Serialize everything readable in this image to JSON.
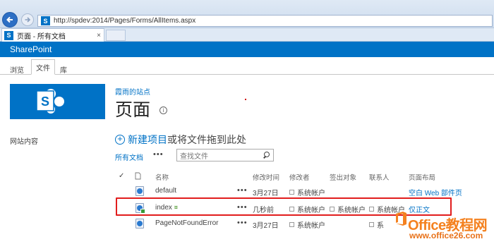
{
  "browser": {
    "url": "http://spdev:2014/Pages/Forms/AllItems.aspx",
    "tab_title": "页面 - 所有文档",
    "tab_close": "×"
  },
  "suite_bar": {
    "brand": "SharePoint"
  },
  "ribbon": {
    "tabs": [
      "浏览",
      "文件",
      "库"
    ],
    "active": "文件"
  },
  "left_nav": {
    "site_contents": "网站内容"
  },
  "header": {
    "site_link": "霞雨的站点",
    "page_title": "页面",
    "info_icon": "i"
  },
  "actions": {
    "new_item_link": "新建项目",
    "new_item_rest": "或将文件拖到此处",
    "view_all": "所有文档",
    "more": "•••",
    "search_placeholder": "查找文件"
  },
  "list": {
    "columns": [
      "名称",
      "修改时间",
      "修改者",
      "签出对象",
      "联系人",
      "页面布局"
    ],
    "rows": [
      {
        "name": "default",
        "modified": "3月27日",
        "modified_by": "系统帐户",
        "checked_out_to": "",
        "contact": "",
        "layout": "空白 Web 部件页",
        "is_new": false
      },
      {
        "name": "index",
        "modified": "几秒前",
        "modified_by": "系统帐户",
        "checked_out_to": "系统帐户",
        "contact": "系统帐户",
        "layout": "仅正文",
        "is_new": true
      },
      {
        "name": "PageNotFoundError",
        "modified": "3月27日",
        "modified_by": "系统帐户",
        "checked_out_to": "",
        "contact": "系",
        "layout": "",
        "is_new": false
      }
    ],
    "new_badge": "¤"
  },
  "watermark": {
    "logo": "Office教程网",
    "url": "www.office26.com"
  },
  "colors": {
    "accent": "#0072c6",
    "highlight": "#e11d1d",
    "watermark": "#f4811f"
  }
}
